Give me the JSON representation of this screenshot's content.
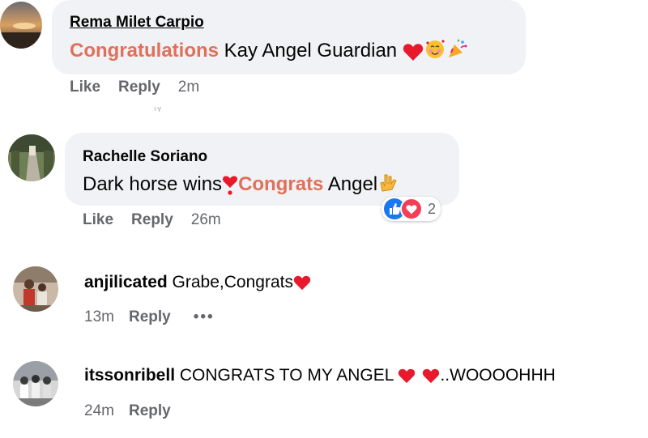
{
  "comments": [
    {
      "author": "Rema Milet Carpio",
      "text_highlight": "Congratulations",
      "text_rest": " Kay Angel Guardian",
      "emojis": [
        "red-heart",
        "smiling-face-hearts",
        "party-popper"
      ],
      "like": "Like",
      "reply": "Reply",
      "time": "2m"
    },
    {
      "author": "Rachelle Soriano",
      "text_part1": "Dark horse wins",
      "text_highlight": "Congrats",
      "text_rest": " Angel",
      "emojis": [
        "heart-exclamation",
        "love-you-gesture"
      ],
      "reaction_count": "2",
      "like": "Like",
      "reply": "Reply",
      "time": "26m"
    },
    {
      "author": "anjilicated",
      "text": "Grabe,Congrats",
      "emojis": [
        "red-heart"
      ],
      "time": "13m",
      "reply": "Reply",
      "more": "•••"
    },
    {
      "author": "itssonribell",
      "text_part1": "CONGRATS TO MY ANGEL ",
      "text_rest": "..WOOOOHHH",
      "emojis": [
        "red-heart",
        "red-heart"
      ],
      "time": "24m",
      "reply": "Reply"
    }
  ],
  "colors": {
    "bubble": "#f0f2f5",
    "highlight": "#e0705a",
    "meta": "#65676b",
    "heart": "#e8192c",
    "like_blue": "#1877f2"
  }
}
